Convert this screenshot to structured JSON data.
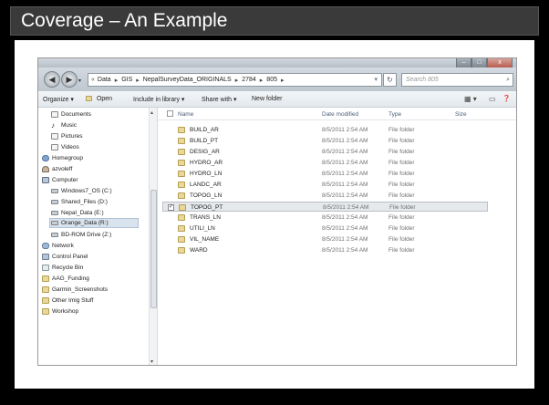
{
  "slide": {
    "title": "Coverage – An Example"
  },
  "window": {
    "controls": {
      "minimize": "–",
      "maximize": "□",
      "close": "x"
    }
  },
  "address": {
    "back_icon": "◀",
    "forward_icon": "▶",
    "history_icon": "▾",
    "lead": "«",
    "separator": "▸",
    "crumbs": [
      "Data",
      "GIS",
      "NepalSurveyData_ORIGINALS",
      "2784",
      "805"
    ],
    "dropdown": "▾",
    "refresh_icon": "↻",
    "search_placeholder": "Search 805",
    "search_icon": "⌕"
  },
  "toolbar": {
    "organize": "Organize ▾",
    "open": "Open",
    "include": "Include in library ▾",
    "share": "Share with ▾",
    "new_folder": "New folder",
    "views_icon": "▦ ▾",
    "preview_icon": "▭",
    "help_icon": "❓"
  },
  "nav_pane": {
    "items": [
      {
        "label": "Documents",
        "icon": "note"
      },
      {
        "label": "Music",
        "icon": "music"
      },
      {
        "label": "Pictures",
        "icon": "note"
      },
      {
        "label": "Videos",
        "icon": "note"
      },
      {
        "label": "Homegroup",
        "icon": "group"
      },
      {
        "label": "azvoleff",
        "icon": "person"
      },
      {
        "label": "Computer",
        "icon": "comp"
      },
      {
        "label": "Windows7_OS (C:)",
        "icon": "drive"
      },
      {
        "label": "Shared_Files (D:)",
        "icon": "drive"
      },
      {
        "label": "Nepal_Data (E:)",
        "icon": "drive"
      },
      {
        "label": "Orange_Data (R:)",
        "icon": "drive",
        "selected": true
      },
      {
        "label": "BD-ROM Drive (Z:)",
        "icon": "drive"
      },
      {
        "label": "Network",
        "icon": "net"
      },
      {
        "label": "Control Panel",
        "icon": "panel"
      },
      {
        "label": "Recycle Bin",
        "icon": "bin"
      },
      {
        "label": "AAG_Funding",
        "icon": "folder"
      },
      {
        "label": "Garmin_Screenshots",
        "icon": "folder"
      },
      {
        "label": "Other Imig Stuff",
        "icon": "folder"
      },
      {
        "label": "Workshop",
        "icon": "folder"
      }
    ],
    "music_glyph": "♪",
    "scroll_up": "▴",
    "scroll_down": "▾"
  },
  "file_list": {
    "headers": {
      "name": "Name",
      "date": "Date modified",
      "type": "Type",
      "size": "Size"
    },
    "rows": [
      {
        "name": "BUILD_AR",
        "date": "8/5/2011 2:54 AM",
        "type": "File folder"
      },
      {
        "name": "BUILD_PT",
        "date": "8/5/2011 2:54 AM",
        "type": "File folder"
      },
      {
        "name": "DESIG_AR",
        "date": "8/5/2011 2:54 AM",
        "type": "File folder"
      },
      {
        "name": "HYDRO_AR",
        "date": "8/5/2011 2:54 AM",
        "type": "File folder"
      },
      {
        "name": "HYDRO_LN",
        "date": "8/5/2011 2:54 AM",
        "type": "File folder"
      },
      {
        "name": "LANDC_AR",
        "date": "8/5/2011 2:54 AM",
        "type": "File folder"
      },
      {
        "name": "TOPOG_LN",
        "date": "8/5/2011 2:54 AM",
        "type": "File folder"
      },
      {
        "name": "TOPOG_PT",
        "date": "8/5/2011 2:54 AM",
        "type": "File folder",
        "selected": true,
        "checked": "✓"
      },
      {
        "name": "TRANS_LN",
        "date": "8/5/2011 2:54 AM",
        "type": "File folder"
      },
      {
        "name": "UTILI_LN",
        "date": "8/5/2011 2:54 AM",
        "type": "File folder"
      },
      {
        "name": "VIL_NAME",
        "date": "8/5/2011 2:54 AM",
        "type": "File folder"
      },
      {
        "name": "WARD",
        "date": "8/5/2011 2:54 AM",
        "type": "File folder"
      }
    ]
  }
}
